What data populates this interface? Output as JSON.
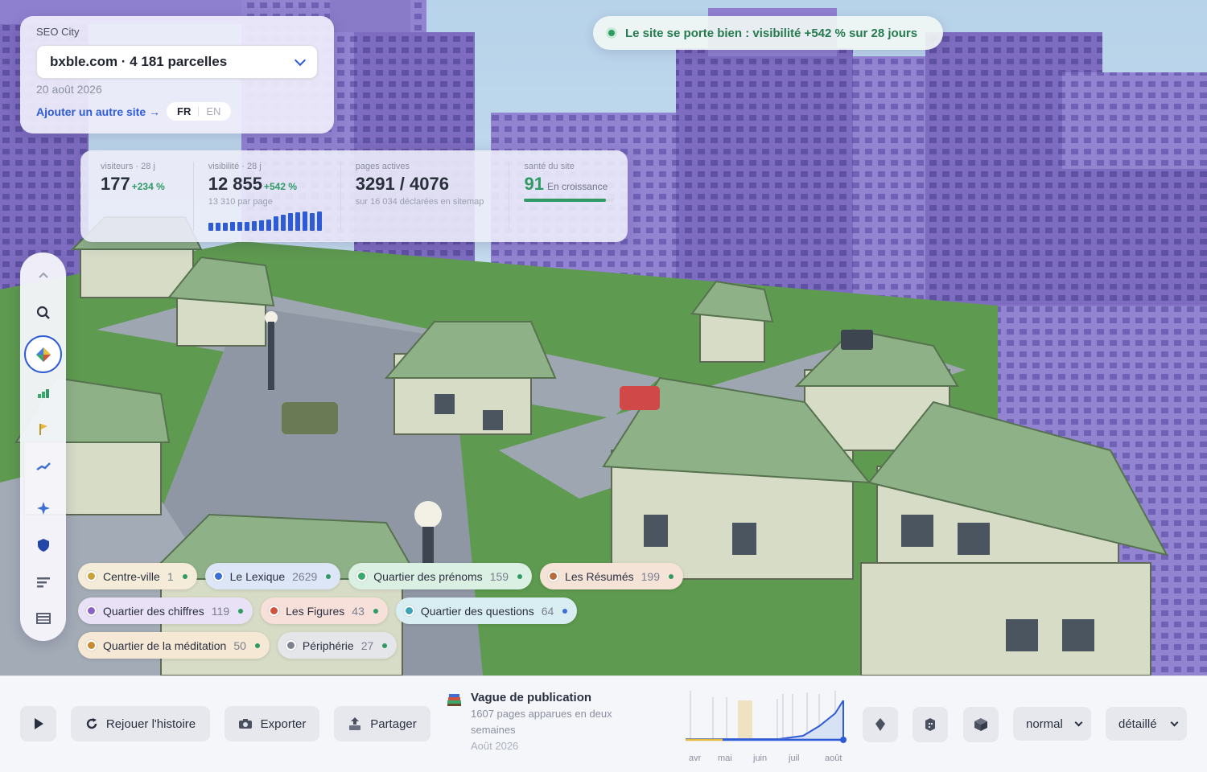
{
  "header": {
    "app_name": "SEO City",
    "site_selector": "bxble.com · 4 181 parcelles",
    "date": "20 août 2026",
    "add_site": "Ajouter un autre site →",
    "lang_fr": "FR",
    "lang_en": "EN",
    "active_lang": "FR"
  },
  "status": {
    "text": "Le site se porte bien : visibilité +542 % sur 28 jours",
    "color": "#2f9a63"
  },
  "stats": {
    "visitors_label": "visiteurs · 28 j",
    "visitors_value": "177",
    "visitors_delta": "+234 %",
    "visibility_label": "visibilité · 28 j",
    "visibility_value": "12 855",
    "visibility_delta": "+542 %",
    "visibility_sub": "13 310 par page",
    "visibility_spark": [
      0.4,
      0.4,
      0.42,
      0.44,
      0.46,
      0.46,
      0.5,
      0.55,
      0.6,
      0.75,
      0.85,
      0.9,
      0.95,
      1.0,
      0.92,
      1.0
    ],
    "pages_label": "pages actives",
    "pages_value": "3291 / 4076",
    "pages_sub": "sur 16 034 déclarées en sitemap",
    "health_label": "santé du site",
    "health_value": "91",
    "health_status": "En croissance",
    "health_level": 0.91
  },
  "toolbar": {
    "icons": [
      "chevron-up-icon",
      "search-icon",
      "layers-icon",
      "bar-chart-icon",
      "flag-icon",
      "trend-icon",
      "sparkle-icon",
      "shield-icon",
      "list-icon",
      "table-icon"
    ],
    "active": "layers-icon"
  },
  "districts": [
    {
      "name": "Centre-ville",
      "count": "1",
      "color": "#c9a23c",
      "bg": "#f4ecd9",
      "status": "#2f9a63"
    },
    {
      "name": "Le Lexique",
      "count": "2629",
      "color": "#3b6fd6",
      "bg": "#dde6f7",
      "status": "#2f9a63"
    },
    {
      "name": "Quartier des prénoms",
      "count": "159",
      "color": "#3aa86a",
      "bg": "#daf0e2",
      "status": "#2f9a63"
    },
    {
      "name": "Les Résumés",
      "count": "199",
      "color": "#b86a3a",
      "bg": "#f5e3d8",
      "status": "#2f9a63"
    },
    {
      "name": "Quartier des chiffres",
      "count": "119",
      "color": "#8a62c7",
      "bg": "#e9e1f5",
      "status": "#2f9a63"
    },
    {
      "name": "Les Figures",
      "count": "43",
      "color": "#d0533e",
      "bg": "#f7e0da",
      "status": "#2f9a63"
    },
    {
      "name": "Quartier des questions",
      "count": "64",
      "color": "#3aa3b8",
      "bg": "#d9eef2",
      "status": "#3b6fd6"
    },
    {
      "name": "Quartier de la méditation",
      "count": "50",
      "color": "#c98a2f",
      "bg": "#f5e8d5",
      "status": "#2f9a63"
    },
    {
      "name": "Périphérie",
      "count": "27",
      "color": "#7d8290",
      "bg": "#e5e6ea",
      "status": "#2f9a63"
    }
  ],
  "bottom": {
    "play": "play-icon",
    "replay": "Rejouer l'histoire",
    "export": "Exporter",
    "share": "Partager",
    "event_title": "Vague de publication",
    "event_desc": "1607 pages apparues en deux semaines",
    "event_date": "Août 2026",
    "timeline_months": [
      "avr",
      "mai",
      "juin",
      "juil",
      "août"
    ],
    "speed": "normal",
    "detail": "détaillé",
    "accent": "#2e5bd6"
  }
}
